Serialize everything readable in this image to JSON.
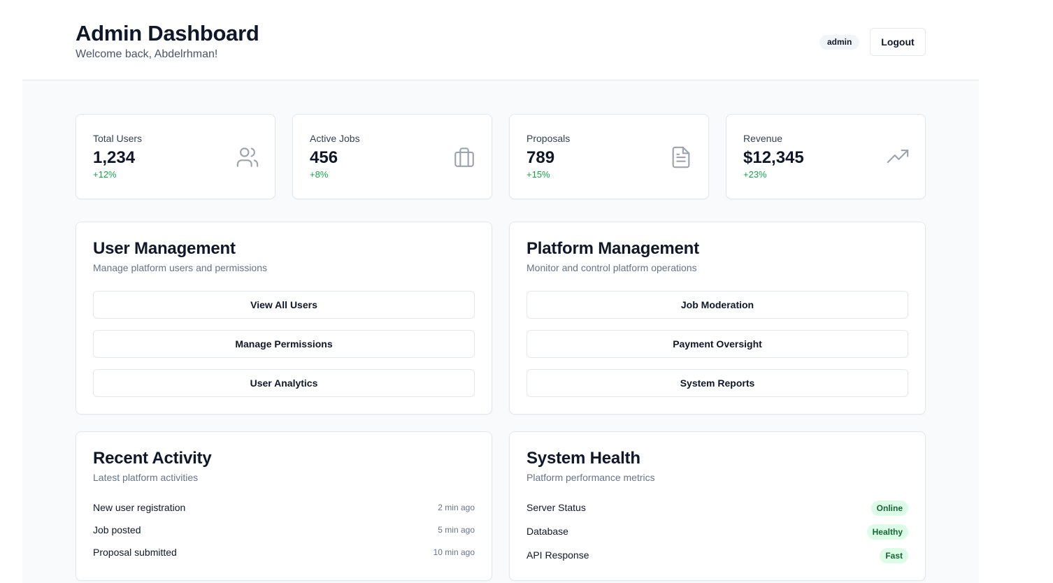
{
  "header": {
    "title": "Admin Dashboard",
    "subtitle": "Welcome back, Abdelrhman!",
    "role_badge": "admin",
    "logout_label": "Logout"
  },
  "stats": [
    {
      "label": "Total Users",
      "value": "1,234",
      "change": "+12%",
      "icon": "users-icon"
    },
    {
      "label": "Active Jobs",
      "value": "456",
      "change": "+8%",
      "icon": "briefcase-icon"
    },
    {
      "label": "Proposals",
      "value": "789",
      "change": "+15%",
      "icon": "document-icon"
    },
    {
      "label": "Revenue",
      "value": "$12,345",
      "change": "+23%",
      "icon": "trending-up-icon"
    }
  ],
  "user_management": {
    "title": "User Management",
    "subtitle": "Manage platform users and permissions",
    "buttons": [
      "View All Users",
      "Manage Permissions",
      "User Analytics"
    ]
  },
  "platform_management": {
    "title": "Platform Management",
    "subtitle": "Monitor and control platform operations",
    "buttons": [
      "Job Moderation",
      "Payment Oversight",
      "System Reports"
    ]
  },
  "recent_activity": {
    "title": "Recent Activity",
    "subtitle": "Latest platform activities",
    "items": [
      {
        "label": "New user registration",
        "time": "2 min ago"
      },
      {
        "label": "Job posted",
        "time": "5 min ago"
      },
      {
        "label": "Proposal submitted",
        "time": "10 min ago"
      }
    ]
  },
  "system_health": {
    "title": "System Health",
    "subtitle": "Platform performance metrics",
    "items": [
      {
        "label": "Server Status",
        "status": "Online"
      },
      {
        "label": "Database",
        "status": "Healthy"
      },
      {
        "label": "API Response",
        "status": "Fast"
      }
    ]
  },
  "colors": {
    "positive": "#16a34a",
    "status_bg": "#dcfce7",
    "status_text": "#166534",
    "icon": "#9ca3af"
  }
}
